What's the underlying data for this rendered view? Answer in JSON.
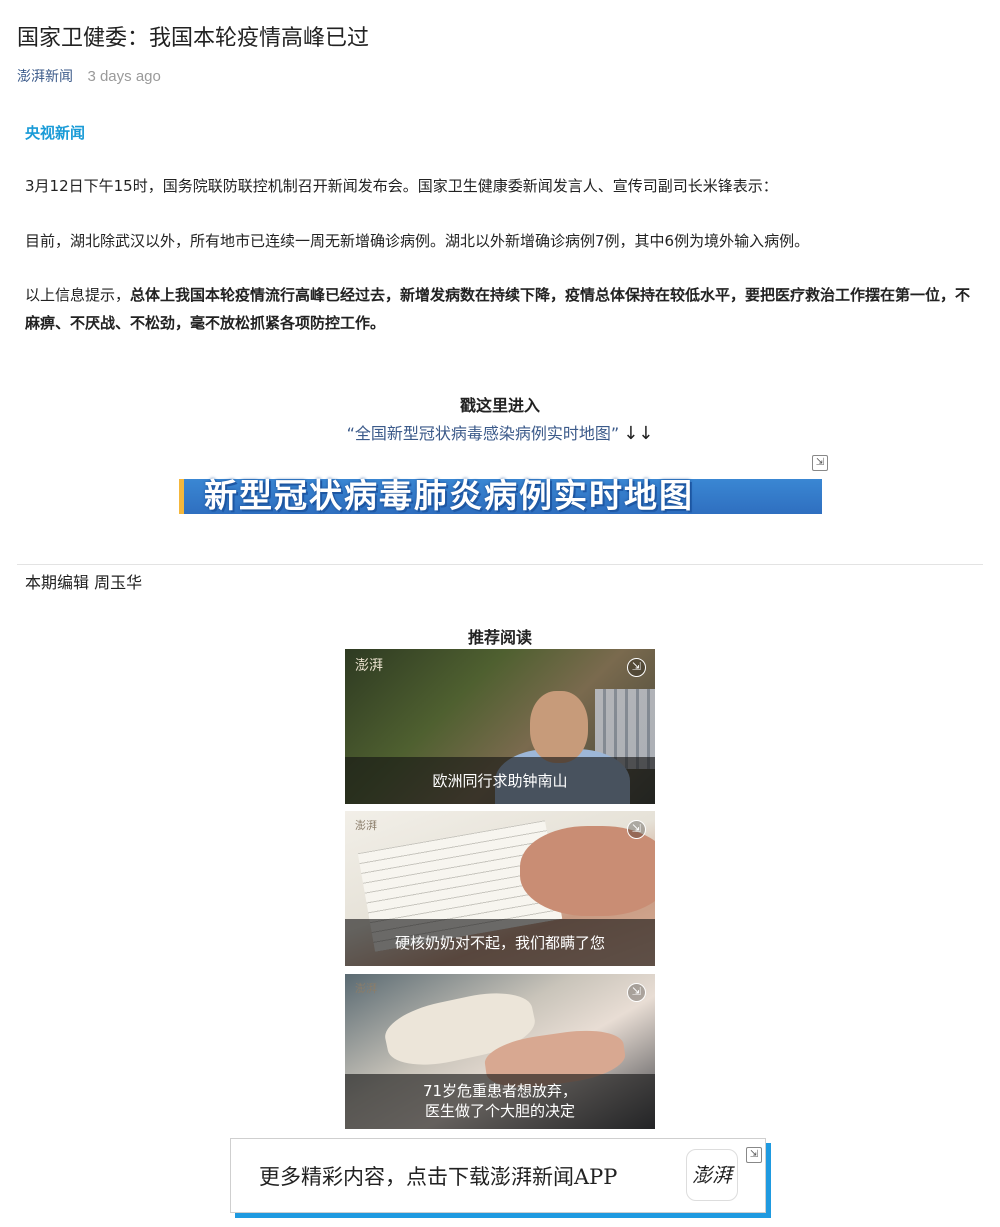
{
  "article": {
    "title": "国家卫健委：我国本轮疫情高峰已过",
    "source": "澎湃新闻",
    "time": "3 days ago",
    "origin": "央视新闻",
    "paragraph1": "3月12日下午15时，国务院联防联控机制召开新闻发布会。国家卫生健康委新闻发言人、宣传司副司长米锋表示：",
    "paragraph2": "目前，湖北除武汉以外，所有地市已连续一周无新增确诊病例。湖北以外新增确诊病例7例，其中6例为境外输入病例。",
    "paragraph3_prefix": "以上信息提示，",
    "paragraph3_bold": "总体上我国本轮疫情流行高峰已经过去，新增发病数在持续下降，疫情总体保持在较低水平，要把医疗救治工作摆在第一位，不麻痹、不厌战、不松劲，毫不放松抓紧各项防控工作。"
  },
  "map_promo": {
    "enter_label": "戳这里进入",
    "link_text": "“全国新型冠状病毒感染病例实时地图”",
    "arrows": "↓↓",
    "banner_text": "新型冠状病毒肺炎病例实时地图",
    "ad_icon": "external-link-icon"
  },
  "editor": "本期编辑 周玉华",
  "recommended": {
    "title": "推荐阅读",
    "logo_text": "澎湃",
    "items": [
      {
        "caption": "欧洲同行求助钟南山"
      },
      {
        "caption": "硬核奶奶对不起，我们都瞒了您"
      },
      {
        "caption_line1": "71岁危重患者想放弃，",
        "caption_line2": "医生做了个大胆的决定"
      }
    ]
  },
  "app_promo": {
    "text": "更多精彩内容，点击下载澎湃新闻APP",
    "logo_text": "澎湃",
    "accent_color": "#1f9ae0"
  },
  "colors": {
    "source_link": "#3b5a8a",
    "origin": "#1a9bd7",
    "banner_blue": "#3a87d3",
    "banner_edge": "#f4b73c"
  }
}
